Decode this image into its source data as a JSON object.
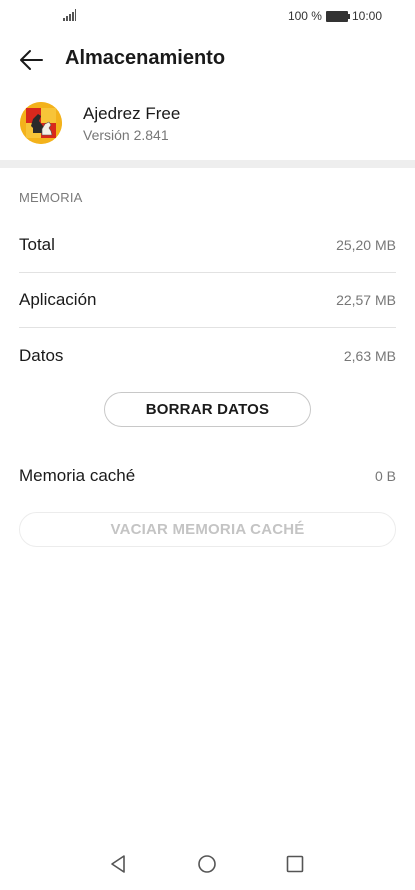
{
  "status": {
    "battery_text": "100 %",
    "time": "10:00"
  },
  "header": {
    "title": "Almacenamiento",
    "back_icon": "arrow-left-icon"
  },
  "app": {
    "name": "Ajedrez Free",
    "version": "Versión 2.841",
    "icon": "chess-app-icon"
  },
  "memory": {
    "section_label": "MEMORIA",
    "rows": [
      {
        "label": "Total",
        "value": "25,20 MB"
      },
      {
        "label": "Aplicación",
        "value": "22,57 MB"
      },
      {
        "label": "Datos",
        "value": "2,63 MB"
      }
    ],
    "clear_data_button": "BORRAR DATOS",
    "cache_label": "Memoria caché",
    "cache_value": "0 B",
    "clear_cache_button": "VACIAR MEMORIA CACHÉ"
  },
  "colors": {
    "accent": "#1a1a1a",
    "muted": "#777777",
    "disabled": "#c4c4c4"
  }
}
